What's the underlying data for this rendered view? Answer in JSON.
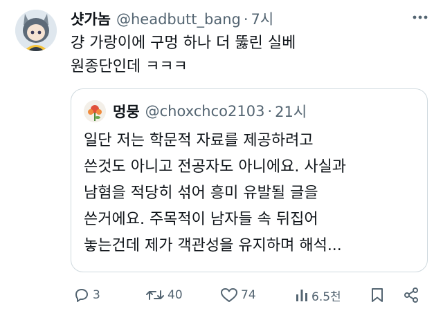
{
  "tweet": {
    "author": {
      "name": "샷가놈",
      "handle": "@headbutt_bang",
      "time": "7시",
      "avatar_icon": "anime-girl-avatar"
    },
    "separator": "·",
    "text_lines": [
      "걍 가랑이에 구멍 하나 더 뚫린 실베",
      "원종단인데 ㅋㅋㅋ"
    ],
    "more_icon": "more-horizontal-icon"
  },
  "quote": {
    "author": {
      "name": "멍뭉",
      "handle": "@choxchco2103",
      "time": "21시",
      "avatar_icon": "flower-avatar"
    },
    "separator": "·",
    "text_lines": [
      "일단 저는 학문적 자료를 제공하려고",
      "쓴것도 아니고 전공자도 아니에요. 사실과",
      "남혐을 적당히 섞어 흥미 유발될 글을",
      "쓴거에요. 주목적이 남자들 속 뒤집어",
      "놓는건데 제가 객관성을 유지하며 해석..."
    ]
  },
  "actions": {
    "reply": {
      "icon": "reply-icon",
      "count": "3"
    },
    "retweet": {
      "icon": "retweet-icon",
      "count": "40"
    },
    "like": {
      "icon": "heart-icon",
      "count": "74"
    },
    "views": {
      "icon": "views-icon",
      "count": "6.5천"
    },
    "bookmark": {
      "icon": "bookmark-icon"
    },
    "share": {
      "icon": "share-icon"
    }
  },
  "colors": {
    "text": "#0f1419",
    "secondary": "#536471",
    "border": "#cfd9de"
  }
}
